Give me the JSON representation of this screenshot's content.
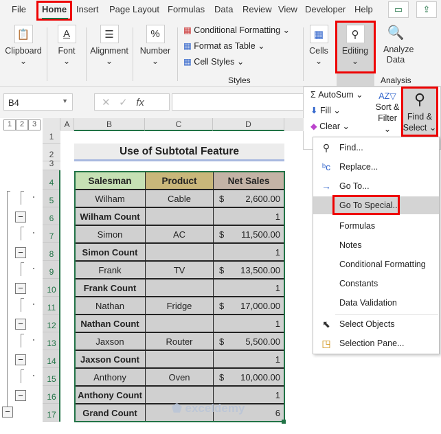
{
  "tabs": [
    "File",
    "Home",
    "Insert",
    "Page Layout",
    "Formulas",
    "Data",
    "Review",
    "View",
    "Developer",
    "Help"
  ],
  "active_tab": "Home",
  "ribbon": {
    "clipboard": "Clipboard",
    "font": "Font",
    "alignment": "Alignment",
    "number": "Number",
    "conditional_formatting": "Conditional Formatting",
    "format_as_table": "Format as Table",
    "cell_styles": "Cell Styles",
    "styles": "Styles",
    "cells": "Cells",
    "editing": "Editing",
    "analyze_data": "Analyze Data",
    "analysis": "Analysis"
  },
  "editing_panel": {
    "autosum": "AutoSum",
    "fill": "Fill",
    "clear": "Clear",
    "sort_filter_1": "Sort &",
    "sort_filter_2": "Filter",
    "find_select_1": "Find &",
    "find_select_2": "Select"
  },
  "name_box": "B4",
  "outline_levels": [
    "1",
    "2",
    "3"
  ],
  "columns": [
    "A",
    "B",
    "C",
    "D"
  ],
  "rows": [
    "1",
    "2",
    "3",
    "4",
    "5",
    "6",
    "7",
    "8",
    "9",
    "10",
    "11",
    "12",
    "13",
    "14",
    "15",
    "16",
    "17"
  ],
  "title": "Use of Subtotal Feature",
  "table": {
    "headers": [
      "Salesman",
      "Product",
      "Net Sales"
    ],
    "header_colors": [
      "#c6e0b4",
      "#c9b77a",
      "#c4b3a6"
    ],
    "rows": [
      {
        "b": "Wilham",
        "c": "Cable",
        "cur": "$",
        "d": "2,600.00"
      },
      {
        "b": "Wilham Count",
        "c": "",
        "cur": "",
        "d": "1",
        "total": true
      },
      {
        "b": "Simon",
        "c": "AC",
        "cur": "$",
        "d": "11,500.00"
      },
      {
        "b": "Simon Count",
        "c": "",
        "cur": "",
        "d": "1",
        "total": true
      },
      {
        "b": "Frank",
        "c": "TV",
        "cur": "$",
        "d": "13,500.00"
      },
      {
        "b": "Frank Count",
        "c": "",
        "cur": "",
        "d": "1",
        "total": true
      },
      {
        "b": "Nathan",
        "c": "Fridge",
        "cur": "$",
        "d": "17,000.00"
      },
      {
        "b": "Nathan Count",
        "c": "",
        "cur": "",
        "d": "1",
        "total": true
      },
      {
        "b": "Jaxson",
        "c": "Router",
        "cur": "$",
        "d": "5,500.00"
      },
      {
        "b": "Jaxson Count",
        "c": "",
        "cur": "",
        "d": "1",
        "total": true
      },
      {
        "b": "Anthony",
        "c": "Oven",
        "cur": "$",
        "d": "10,000.00"
      },
      {
        "b": "Anthony Count",
        "c": "",
        "cur": "",
        "d": "1",
        "total": true
      },
      {
        "b": "Grand Count",
        "c": "",
        "cur": "",
        "d": "6",
        "total": true
      }
    ]
  },
  "menu": [
    "Find...",
    "Replace...",
    "Go To...",
    "Go To Special...",
    "Formulas",
    "Notes",
    "Conditional Formatting",
    "Constants",
    "Data Validation",
    "Select Objects",
    "Selection Pane..."
  ],
  "watermark": "exceldemy EXCEL · DATA · BI"
}
